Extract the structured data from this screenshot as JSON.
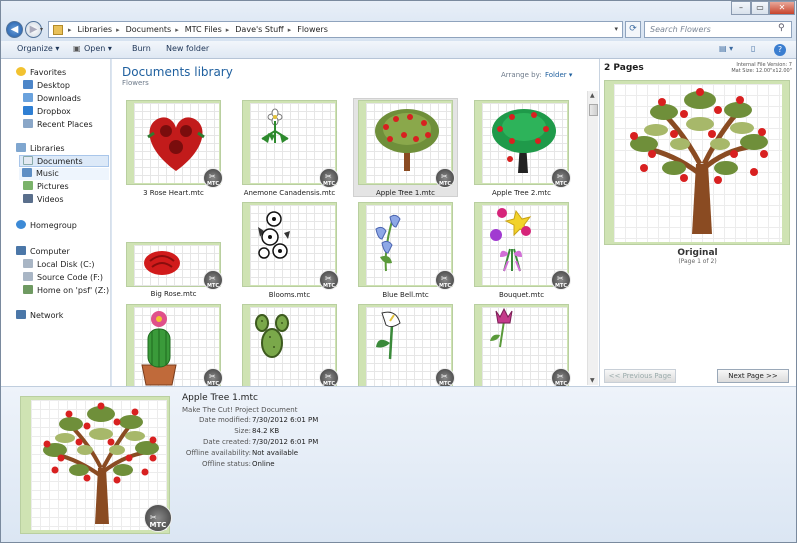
{
  "window": {
    "controls": [
      "–",
      "▭",
      "✕"
    ],
    "address": {
      "crumbs": [
        "Libraries",
        "Documents",
        "MTC Files",
        "Dave's Stuff",
        "Flowers"
      ]
    },
    "search_placeholder": "Search Flowers"
  },
  "toolbar": {
    "organize": "Organize ▾",
    "open": "Open ▾",
    "burn": "Burn",
    "new_folder": "New folder"
  },
  "sidebar": {
    "favorites": "Favorites",
    "fav_items": [
      "Desktop",
      "Downloads",
      "Dropbox",
      "Recent Places"
    ],
    "libraries": "Libraries",
    "lib_items": [
      "Documents",
      "Music",
      "Pictures",
      "Videos"
    ],
    "homegroup": "Homegroup",
    "computer": "Computer",
    "comp_items": [
      "Local Disk (C:)",
      "Source Code (F:)",
      "Home on 'psf' (Z:)"
    ],
    "network": "Network"
  },
  "library": {
    "title": "Documents library",
    "subtitle": "Flowers",
    "arrange_label": "Arrange by:",
    "arrange_value": "Folder ▾"
  },
  "files": [
    {
      "name": "3 Rose Heart.mtc"
    },
    {
      "name": "Anemone Canadensis.mtc"
    },
    {
      "name": "Apple Tree 1.mtc"
    },
    {
      "name": "Apple Tree 2.mtc"
    },
    {
      "name": "Big Rose.mtc"
    },
    {
      "name": "Blooms.mtc"
    },
    {
      "name": "Blue Bell.mtc"
    },
    {
      "name": "Bouquet.mtc"
    },
    {
      "name": ""
    },
    {
      "name": ""
    },
    {
      "name": ""
    },
    {
      "name": ""
    }
  ],
  "badge_text": "MTC",
  "preview": {
    "pages": "2 Pages",
    "info_line1": "Internal File Version: 7",
    "info_line2": "Mat Size: 12.00\"x12.00\"",
    "title": "Original",
    "subtitle": "(Page 1 of 2)",
    "prev_btn": "<< Previous Page",
    "next_btn": "Next Page >>"
  },
  "details": {
    "filename": "Apple Tree 1.mtc",
    "filetype": "Make The Cut! Project Document",
    "rows": [
      {
        "label": "Date modified:",
        "value": "7/30/2012 6:01 PM"
      },
      {
        "label": "Size:",
        "value": "84.2 KB"
      },
      {
        "label": "Date created:",
        "value": "7/30/2012 6:01 PM"
      },
      {
        "label": "Offline availability:",
        "value": "Not available"
      },
      {
        "label": "Offline status:",
        "value": "Online"
      }
    ]
  },
  "colors": {
    "accent": "#1e5f9e",
    "mat_green": "#cfe3b3",
    "selection": "#dce9f8"
  }
}
